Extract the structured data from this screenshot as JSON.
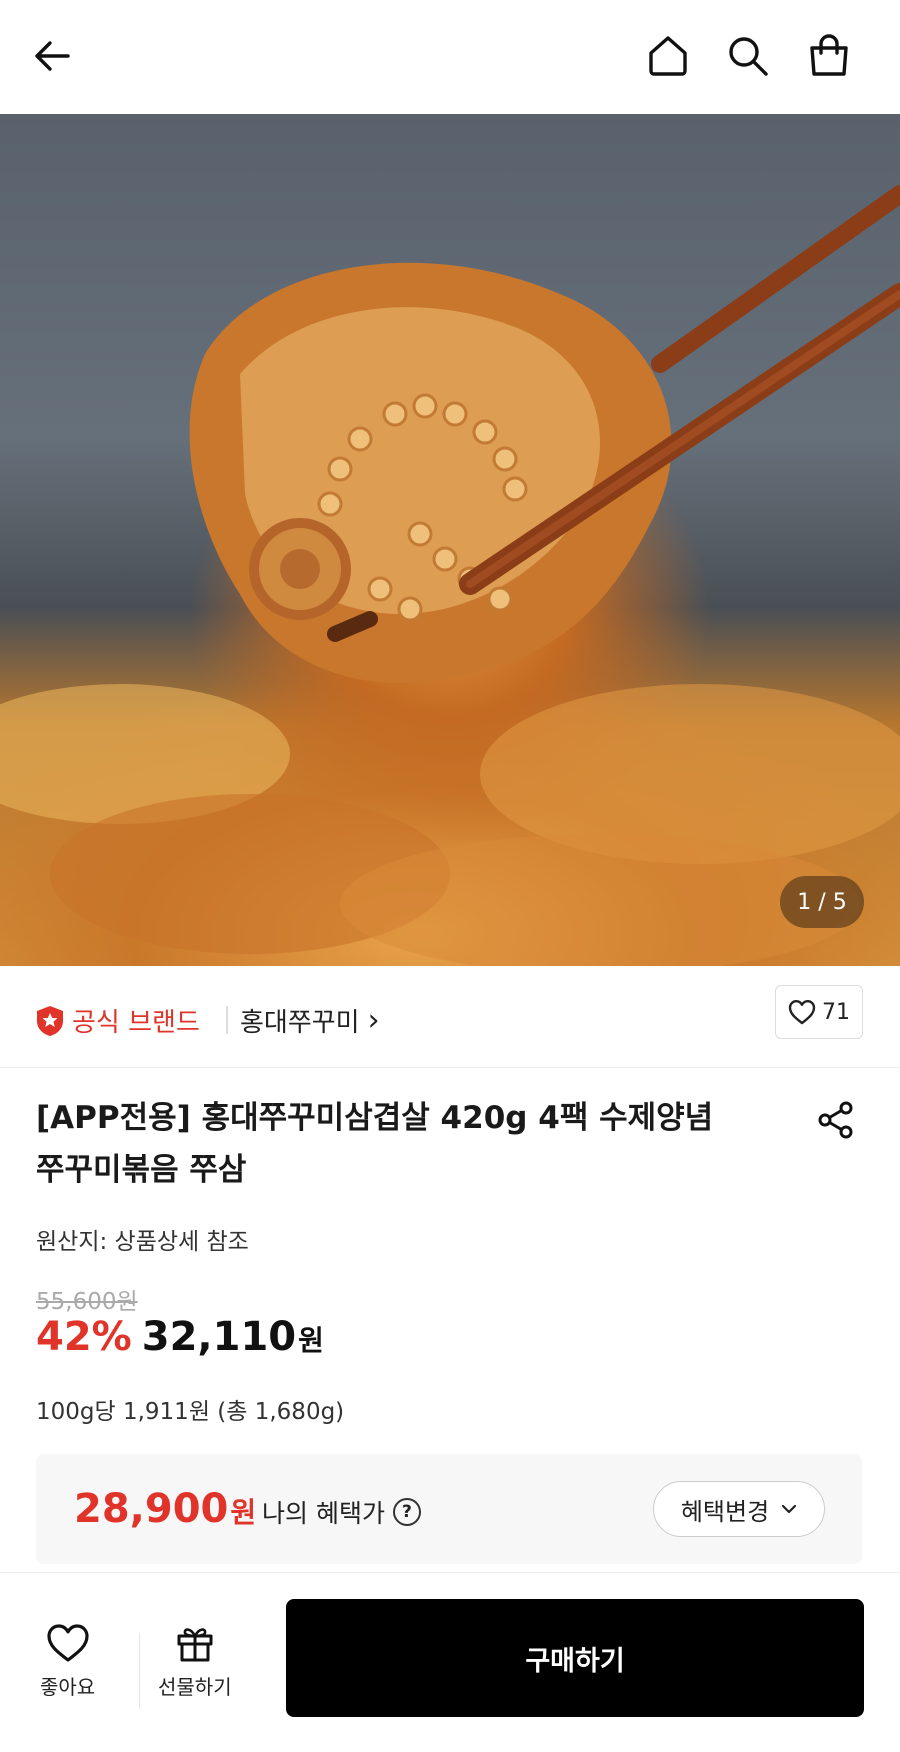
{
  "header": {
    "back_icon": "arrow-left-icon",
    "home_icon": "home-icon",
    "search_icon": "search-icon",
    "cart_icon": "shopping-bag-icon"
  },
  "gallery": {
    "counter": "1 / 5"
  },
  "brand": {
    "badge_label": "공식 브랜드",
    "name": "홍대쭈꾸미",
    "chevron": "›",
    "like_count": "71",
    "accent_color": "#e0342a"
  },
  "product": {
    "title_line1": "[APP전용] 홍대쭈꾸미삼겹살 420g 4팩 수제양념",
    "title_line2": "쭈꾸미볶음 쭈삼",
    "origin": "원산지: 상품상세 참조",
    "original_price": "55,600원",
    "discount_percent": "42%",
    "sale_price": "32,110",
    "sale_price_unit": "원",
    "unit_price": "100g당 1,911원 (총 1,680g)"
  },
  "benefit": {
    "price": "28,900",
    "price_unit": "원",
    "label": "나의 혜택가",
    "help_glyph": "?",
    "change_label": "혜택변경"
  },
  "bottom": {
    "like_label": "좋아요",
    "gift_label": "선물하기",
    "buy_label": "구매하기"
  }
}
